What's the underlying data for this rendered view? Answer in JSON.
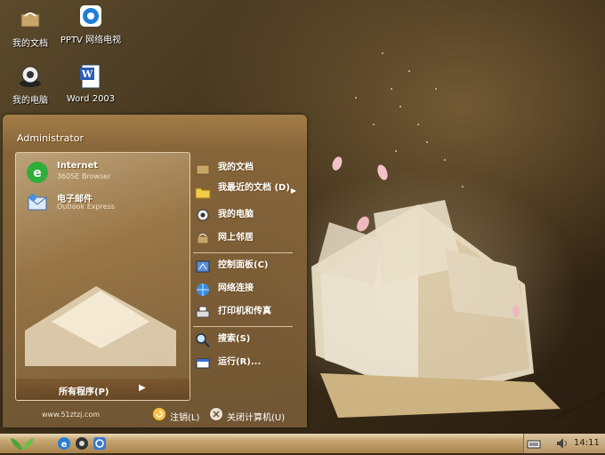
{
  "desktop": {
    "icons": [
      {
        "label": "我的文档",
        "icon": "folder-icon"
      },
      {
        "label": "PPTV 网络电视",
        "icon": "pptv-icon"
      },
      {
        "label": "我的电脑",
        "icon": "computer-icon"
      },
      {
        "label": "Word 2003",
        "icon": "word-icon"
      }
    ]
  },
  "start_menu": {
    "user": "Administrator",
    "pinned": [
      {
        "title": "Internet",
        "subtitle": "360SE Browser",
        "icon": "browser-icon"
      },
      {
        "title": "电子邮件",
        "subtitle": "Outlook Express",
        "icon": "mail-icon"
      }
    ],
    "all_programs": "所有程序(P)",
    "right_items": [
      {
        "label": "我的文档",
        "icon": "folder-icon"
      },
      {
        "label": "我最近的文档 (D)",
        "icon": "recent-docs-icon"
      },
      {
        "label": "我的电脑",
        "icon": "computer-icon"
      },
      {
        "label": "网上邻居",
        "icon": "network-places-icon"
      },
      {
        "label": "控制面板(C)",
        "icon": "control-panel-icon"
      },
      {
        "label": "网络连接",
        "icon": "network-connections-icon"
      },
      {
        "label": "打印机和传真",
        "icon": "printer-icon"
      },
      {
        "label": "搜索(S)",
        "icon": "search-icon"
      },
      {
        "label": "运行(R)...",
        "icon": "run-icon"
      }
    ],
    "website": "www.51ztzj.com",
    "logoff": "注销(L)",
    "shutdown": "关闭计算机(U)"
  },
  "taskbar": {
    "clock": "14:11",
    "quick_launch": [
      "browser-icon",
      "media-icon",
      "ie-icon"
    ],
    "tray": [
      "keyboard-icon",
      "volume-icon"
    ]
  },
  "colors": {
    "accent": "#a8814a",
    "menu": "#8c6a3c"
  }
}
